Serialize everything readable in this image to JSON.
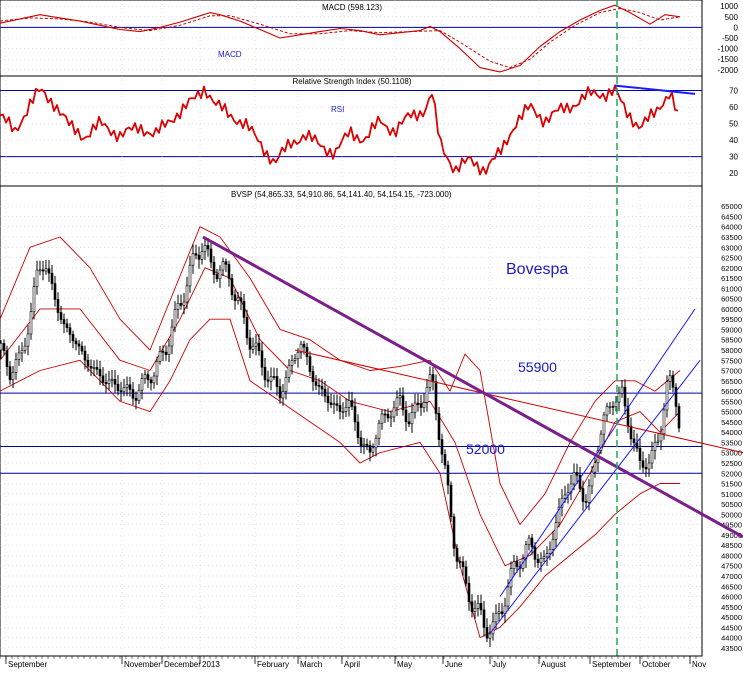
{
  "chart_data": {
    "type": "candlestick",
    "colors": {
      "background": "#ffffff",
      "grid": "#c8c8c8",
      "candles": "#000000",
      "macd": "#cc0000",
      "rsi": "#dd0000",
      "bollinger": "#cc0000",
      "level_lines": "#0000aa",
      "downtrend": "#7a1f8a",
      "channel": "#1a1aff",
      "rsi_trend": "#1a1aff",
      "event_line": "#22aa55",
      "annotation": "#1a1acc"
    },
    "x_axis": {
      "months": [
        "September",
        "November",
        "December",
        "2013",
        "February",
        "March",
        "April",
        "May",
        "June",
        "July",
        "August",
        "September",
        "October",
        "Nov"
      ],
      "month_index": [
        6,
        122,
        162,
        200,
        255,
        298,
        342,
        395,
        443,
        490,
        539,
        590,
        640,
        690
      ]
    },
    "macd_panel": {
      "title": "MACD (598.123)",
      "series_label": "MACD",
      "y_ticks": [
        1000,
        500,
        0,
        -500,
        -1000,
        -1500,
        -2000
      ],
      "ylim": [
        -2200,
        1200
      ],
      "zero_line": 0,
      "macd": [
        [
          0,
          200
        ],
        [
          20,
          400
        ],
        [
          40,
          600
        ],
        [
          60,
          450
        ],
        [
          80,
          300
        ],
        [
          100,
          100
        ],
        [
          120,
          -100
        ],
        [
          140,
          -200
        ],
        [
          160,
          0
        ],
        [
          180,
          250
        ],
        [
          200,
          550
        ],
        [
          210,
          700
        ],
        [
          220,
          600
        ],
        [
          240,
          300
        ],
        [
          260,
          -100
        ],
        [
          280,
          -500
        ],
        [
          300,
          -350
        ],
        [
          320,
          -200
        ],
        [
          340,
          -50
        ],
        [
          360,
          -150
        ],
        [
          380,
          -350
        ],
        [
          400,
          -250
        ],
        [
          420,
          -150
        ],
        [
          430,
          50
        ],
        [
          440,
          -200
        ],
        [
          460,
          -1000
        ],
        [
          480,
          -1900
        ],
        [
          500,
          -2100
        ],
        [
          520,
          -1800
        ],
        [
          540,
          -900
        ],
        [
          560,
          -200
        ],
        [
          580,
          350
        ],
        [
          600,
          800
        ],
        [
          615,
          1050
        ],
        [
          630,
          700
        ],
        [
          650,
          150
        ],
        [
          665,
          600
        ],
        [
          680,
          500
        ]
      ],
      "signal": [
        [
          0,
          300
        ],
        [
          30,
          450
        ],
        [
          60,
          400
        ],
        [
          90,
          250
        ],
        [
          120,
          0
        ],
        [
          150,
          -150
        ],
        [
          180,
          100
        ],
        [
          210,
          550
        ],
        [
          230,
          550
        ],
        [
          260,
          150
        ],
        [
          290,
          -300
        ],
        [
          320,
          -300
        ],
        [
          350,
          -150
        ],
        [
          380,
          -250
        ],
        [
          410,
          -200
        ],
        [
          440,
          -150
        ],
        [
          460,
          -700
        ],
        [
          490,
          -1600
        ],
        [
          510,
          -1900
        ],
        [
          530,
          -1500
        ],
        [
          550,
          -700
        ],
        [
          575,
          100
        ],
        [
          600,
          700
        ],
        [
          620,
          900
        ],
        [
          640,
          700
        ],
        [
          660,
          350
        ],
        [
          680,
          500
        ]
      ]
    },
    "rsi_panel": {
      "title": "Relative Strength Index (50.1108)",
      "series_label": "RSI",
      "y_ticks": [
        70,
        60,
        50,
        40,
        30,
        20
      ],
      "ylim": [
        14,
        77
      ],
      "levels": [
        70,
        30
      ],
      "rsi": [
        [
          0,
          55
        ],
        [
          15,
          45
        ],
        [
          30,
          62
        ],
        [
          40,
          70
        ],
        [
          55,
          62
        ],
        [
          70,
          48
        ],
        [
          85,
          42
        ],
        [
          100,
          50
        ],
        [
          120,
          43
        ],
        [
          140,
          48
        ],
        [
          155,
          43
        ],
        [
          170,
          52
        ],
        [
          185,
          60
        ],
        [
          195,
          65
        ],
        [
          205,
          72
        ],
        [
          215,
          62
        ],
        [
          230,
          55
        ],
        [
          245,
          50
        ],
        [
          260,
          38
        ],
        [
          275,
          26
        ],
        [
          290,
          38
        ],
        [
          305,
          43
        ],
        [
          320,
          37
        ],
        [
          335,
          32
        ],
        [
          350,
          45
        ],
        [
          365,
          40
        ],
        [
          380,
          52
        ],
        [
          395,
          45
        ],
        [
          410,
          55
        ],
        [
          425,
          58
        ],
        [
          432,
          68
        ],
        [
          440,
          38
        ],
        [
          455,
          22
        ],
        [
          470,
          28
        ],
        [
          485,
          22
        ],
        [
          500,
          32
        ],
        [
          515,
          50
        ],
        [
          530,
          60
        ],
        [
          545,
          52
        ],
        [
          560,
          58
        ],
        [
          575,
          62
        ],
        [
          590,
          68
        ],
        [
          605,
          68
        ],
        [
          615,
          70
        ],
        [
          625,
          58
        ],
        [
          640,
          48
        ],
        [
          655,
          56
        ],
        [
          670,
          70
        ],
        [
          680,
          50
        ]
      ],
      "trendline": [
        [
          615,
          73
        ],
        [
          695,
          68
        ]
      ]
    },
    "price_panel": {
      "title": "BVSP (54,865.33, 54,910.86, 54,141.40, 54,154.15, -723.000)",
      "y_ticks": [
        65000,
        64500,
        64000,
        63500,
        63000,
        62500,
        62000,
        61500,
        61000,
        60500,
        60000,
        59500,
        59000,
        58500,
        58000,
        57500,
        57000,
        56500,
        56000,
        55500,
        55000,
        54500,
        54000,
        53500,
        53000,
        52500,
        52000,
        51500,
        51000,
        50500,
        50000,
        49500,
        49000,
        48500,
        48000,
        47500,
        47000,
        46500,
        46000,
        45500,
        45000,
        44500,
        44000,
        43500
      ],
      "ylim": [
        43300,
        65300
      ],
      "price_path": [
        [
          0,
          58000
        ],
        [
          10,
          57000
        ],
        [
          20,
          57500
        ],
        [
          30,
          59500
        ],
        [
          38,
          62000
        ],
        [
          45,
          62200
        ],
        [
          55,
          60500
        ],
        [
          65,
          59000
        ],
        [
          75,
          58500
        ],
        [
          85,
          57500
        ],
        [
          95,
          57000
        ],
        [
          105,
          56500
        ],
        [
          120,
          56200
        ],
        [
          135,
          55800
        ],
        [
          145,
          56500
        ],
        [
          155,
          57000
        ],
        [
          165,
          58000
        ],
        [
          175,
          59500
        ],
        [
          185,
          61000
        ],
        [
          195,
          62500
        ],
        [
          203,
          63300
        ],
        [
          210,
          62000
        ],
        [
          220,
          62000
        ],
        [
          230,
          61500
        ],
        [
          240,
          60000
        ],
        [
          250,
          58500
        ],
        [
          260,
          57500
        ],
        [
          270,
          56500
        ],
        [
          280,
          56000
        ],
        [
          290,
          57000
        ],
        [
          300,
          58500
        ],
        [
          310,
          57000
        ],
        [
          320,
          56000
        ],
        [
          330,
          55500
        ],
        [
          340,
          55000
        ],
        [
          350,
          55500
        ],
        [
          360,
          53500
        ],
        [
          370,
          53000
        ],
        [
          380,
          54500
        ],
        [
          390,
          55000
        ],
        [
          400,
          55500
        ],
        [
          410,
          54500
        ],
        [
          420,
          55500
        ],
        [
          432,
          56500
        ],
        [
          438,
          54500
        ],
        [
          445,
          52000
        ],
        [
          455,
          48500
        ],
        [
          465,
          46500
        ],
        [
          475,
          45500
        ],
        [
          485,
          44500
        ],
        [
          495,
          44500
        ],
        [
          505,
          46000
        ],
        [
          515,
          47500
        ],
        [
          530,
          48500
        ],
        [
          545,
          47500
        ],
        [
          555,
          49500
        ],
        [
          565,
          51000
        ],
        [
          575,
          52000
        ],
        [
          585,
          50500
        ],
        [
          595,
          52500
        ],
        [
          605,
          55000
        ],
        [
          615,
          55500
        ],
        [
          622,
          56000
        ],
        [
          630,
          54000
        ],
        [
          640,
          52500
        ],
        [
          650,
          52500
        ],
        [
          660,
          54000
        ],
        [
          668,
          56500
        ],
        [
          675,
          56000
        ],
        [
          680,
          54200
        ]
      ],
      "upper_band": [
        [
          0,
          59500
        ],
        [
          30,
          63000
        ],
        [
          60,
          63500
        ],
        [
          90,
          62000
        ],
        [
          120,
          59500
        ],
        [
          150,
          58000
        ],
        [
          175,
          61000
        ],
        [
          200,
          64000
        ],
        [
          220,
          63500
        ],
        [
          250,
          61500
        ],
        [
          280,
          59000
        ],
        [
          310,
          58500
        ],
        [
          340,
          57500
        ],
        [
          370,
          57000
        ],
        [
          400,
          57200
        ],
        [
          430,
          57500
        ],
        [
          450,
          56000
        ],
        [
          465,
          57800
        ],
        [
          480,
          57000
        ],
        [
          500,
          51500
        ],
        [
          520,
          49500
        ],
        [
          545,
          51000
        ],
        [
          570,
          53500
        ],
        [
          595,
          55500
        ],
        [
          615,
          56500
        ],
        [
          635,
          56500
        ],
        [
          655,
          56000
        ],
        [
          680,
          57000
        ]
      ],
      "middle_band": [
        [
          0,
          57500
        ],
        [
          40,
          60000
        ],
        [
          80,
          60000
        ],
        [
          120,
          57500
        ],
        [
          150,
          57000
        ],
        [
          180,
          59500
        ],
        [
          205,
          62000
        ],
        [
          230,
          61500
        ],
        [
          260,
          58500
        ],
        [
          290,
          57000
        ],
        [
          320,
          56500
        ],
        [
          350,
          55500
        ],
        [
          390,
          55000
        ],
        [
          430,
          55500
        ],
        [
          455,
          53500
        ],
        [
          480,
          50000
        ],
        [
          505,
          47500
        ],
        [
          530,
          48000
        ],
        [
          560,
          49500
        ],
        [
          590,
          52000
        ],
        [
          615,
          54500
        ],
        [
          640,
          55000
        ],
        [
          660,
          54000
        ],
        [
          680,
          55000
        ]
      ],
      "lower_band": [
        [
          0,
          56000
        ],
        [
          40,
          57000
        ],
        [
          80,
          57500
        ],
        [
          120,
          55500
        ],
        [
          150,
          55000
        ],
        [
          170,
          56500
        ],
        [
          190,
          58500
        ],
        [
          210,
          59500
        ],
        [
          230,
          59500
        ],
        [
          250,
          56500
        ],
        [
          280,
          55500
        ],
        [
          310,
          54500
        ],
        [
          340,
          53500
        ],
        [
          360,
          52500
        ],
        [
          380,
          53000
        ],
        [
          420,
          53500
        ],
        [
          440,
          52000
        ],
        [
          460,
          47500
        ],
        [
          480,
          44000
        ],
        [
          500,
          44500
        ],
        [
          520,
          45500
        ],
        [
          545,
          47000
        ],
        [
          570,
          48000
        ],
        [
          595,
          49000
        ],
        [
          615,
          50000
        ],
        [
          640,
          51000
        ],
        [
          660,
          51500
        ],
        [
          680,
          51500
        ]
      ],
      "levels": [
        {
          "label": "55900",
          "value": 55900
        },
        {
          "label": "52000",
          "value": 52000
        },
        {
          "label": "",
          "value": 53300
        }
      ],
      "downtrend": [
        [
          203,
          63500
        ],
        [
          743,
          48900
        ]
      ],
      "resistance": [
        [
          295,
          58000
        ],
        [
          743,
          53000
        ]
      ],
      "channel_upper": [
        [
          500,
          46000
        ],
        [
          695,
          60000
        ]
      ],
      "channel_lower": [
        [
          490,
          44200
        ],
        [
          700,
          57500
        ]
      ],
      "annotation": "Bovespa"
    },
    "event_x": 617
  }
}
